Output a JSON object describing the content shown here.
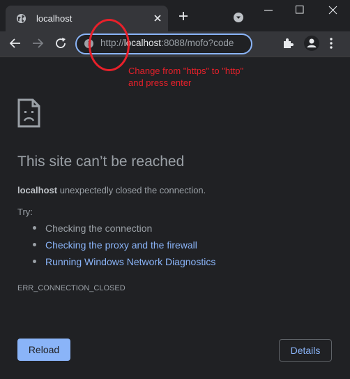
{
  "tab": {
    "title": "localhost"
  },
  "address_bar": {
    "url_scheme": "http://",
    "url_host": "localhost",
    "url_rest": ":8088/mofo?code"
  },
  "annotation": {
    "text": "Change from \"https\" to \"http\" and press enter",
    "color": "#e8202a"
  },
  "error_page": {
    "heading": "This site can’t be reached",
    "host": "localhost",
    "message": " unexpectedly closed the connection.",
    "try_label": "Try:",
    "suggestions": [
      {
        "label": "Checking the connection",
        "link": false
      },
      {
        "label": "Checking the proxy and the firewall",
        "link": true
      },
      {
        "label": "Running Windows Network Diagnostics",
        "link": true
      }
    ],
    "error_code": "ERR_CONNECTION_CLOSED",
    "reload_label": "Reload",
    "details_label": "Details"
  },
  "icons": [
    "globe-icon",
    "close-tab-icon",
    "new-tab-icon",
    "tab-search-icon",
    "minimize-icon",
    "maximize-icon",
    "close-window-icon",
    "back-icon",
    "forward-icon",
    "reload-icon",
    "info-icon",
    "extensions-icon",
    "profile-icon",
    "menu-icon",
    "sad-page-icon"
  ],
  "colors": {
    "accent": "#8ab4f8",
    "background": "#202124",
    "toolbar": "#35363a"
  }
}
